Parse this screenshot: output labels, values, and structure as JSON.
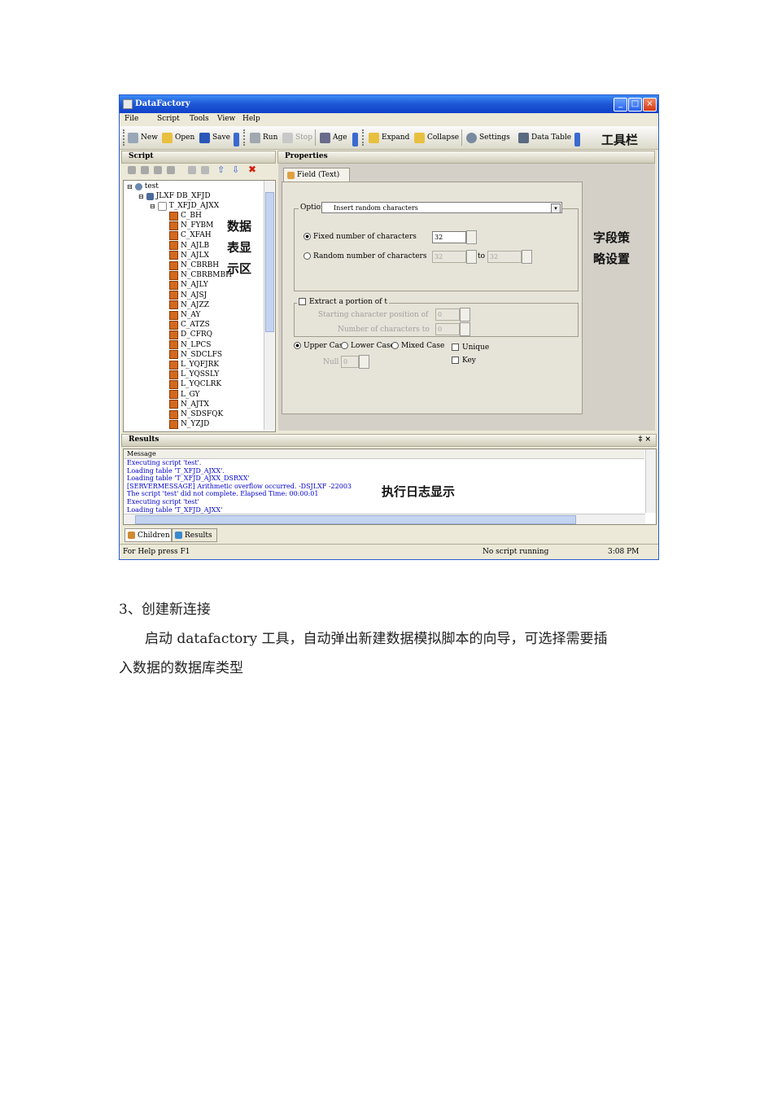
{
  "window": {
    "title": "DataFactory"
  },
  "menu": [
    "File",
    "Script",
    "Tools",
    "View",
    "Help"
  ],
  "toolbar": {
    "new": "New",
    "open": "Open",
    "save": "Save",
    "run": "Run",
    "stop": "Stop",
    "age": "Age",
    "expand": "Expand",
    "collapse": "Collapse",
    "settings": "Settings",
    "data_table": "Data Table"
  },
  "annotations": {
    "toolbar": "工具栏",
    "data_table_area": [
      "数据",
      "表显",
      "示区"
    ],
    "field_strategy": [
      "字段策",
      "略设置"
    ],
    "log_display": "执行日志显示"
  },
  "script_panel": {
    "header": "Script",
    "tree": {
      "root": "test",
      "db": "JLXF DB_XFJD",
      "table": "T_XFJD_AJXX",
      "fields": [
        "C_BH",
        "N_FYBM",
        "C_XFAH",
        "N_AJLB",
        "N_AJLX",
        "N_CBRBH",
        "N_CBRBMBH",
        "N_AJLY",
        "N_AJSJ",
        "N_AJZZ",
        "N_AY",
        "C_ATZS",
        "D_CFRQ",
        "N_LPCS",
        "N_SDCLFS",
        "L_YQFJRK",
        "L_YQSSLY",
        "L_YQCLRK",
        "L_GY",
        "N_AJTX",
        "N_SDSFQK",
        "N_YZJD"
      ]
    }
  },
  "properties": {
    "header": "Properties",
    "tab": "Field (Text)",
    "options_label": "Option",
    "options_value": "Insert random characters",
    "fixed_label": "Fixed number of characters",
    "fixed_value": "32",
    "random_label": "Random number of characters",
    "random_from": "32",
    "random_to_label": "to",
    "random_to": "32",
    "extract_label": "Extract a portion of t",
    "start_pos_label": "Starting character position of",
    "start_pos_value": "0",
    "num_chars_label": "Number of characters to",
    "num_chars_value": "0",
    "upper": "Upper Case",
    "lower": "Lower Case",
    "mixed": "Mixed Case",
    "unique": "Unique",
    "key": "Key",
    "null_label": "Null",
    "null_value": "0"
  },
  "results": {
    "header": "Results",
    "pin": "‡ ×",
    "column": "Message",
    "lines": [
      "Executing script 'test'.",
      "Loading table 'T_XFJD_AJXX'.",
      "Loading table 'T_XFJD_AJXX_DSRXX'",
      "[SERVERMESSAGE] Arithmetic overflow occurred. -DSJLXF -22003",
      "The script 'test' did not complete.  Elapsed Time: 00:00:01",
      "Executing script 'test'",
      "Loading table 'T_XFJD_AJXX'"
    ]
  },
  "bottom_tabs": [
    "Children",
    "Results"
  ],
  "status": {
    "help": "For Help press F1",
    "state": "No script running",
    "time": "3:08 PM"
  },
  "document": {
    "heading": "3、创建新连接",
    "para_line1": "启动 datafactory 工具，自动弹出新建数据模拟脚本的向导，可选择需要插",
    "para_line2": "入数据的数据库类型"
  },
  "colors": {
    "titlebar": "#1e56d6",
    "log_text": "#0000cc",
    "window_bg": "#ece9d8"
  }
}
